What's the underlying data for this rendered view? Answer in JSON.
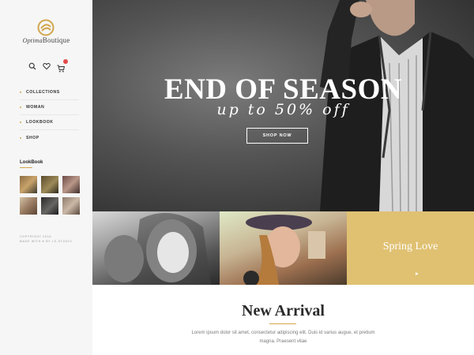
{
  "brand": {
    "script_part": "Optima",
    "name_part": "Boutique",
    "accent_color": "#d1a64e"
  },
  "header_icons": [
    {
      "name": "search-icon"
    },
    {
      "name": "heart-icon"
    },
    {
      "name": "cart-icon",
      "badge": ""
    }
  ],
  "sidebar": {
    "menu": [
      {
        "label": "COLLECTIONS"
      },
      {
        "label": "WOMAN"
      },
      {
        "label": "LOOKBOOK"
      },
      {
        "label": "SHOP"
      }
    ],
    "lookbook_title": "LookBook",
    "copyright_line1": "COPYRIGHT 2018",
    "copyright_line2": "MADE WITH ♥ BY LS-STUDIO"
  },
  "hero": {
    "title": "END OF SEASON",
    "subtitle": "up to 50% off",
    "button": "SHOP NOW"
  },
  "tiles": {
    "third_label": "Spring Love"
  },
  "new_arrival": {
    "title": "New Arrival",
    "text": "Lorem ipsum dolor sit amet, consectetur adipiscing elit. Duis id varius augue, et pretium magna. Praesent vitae"
  }
}
